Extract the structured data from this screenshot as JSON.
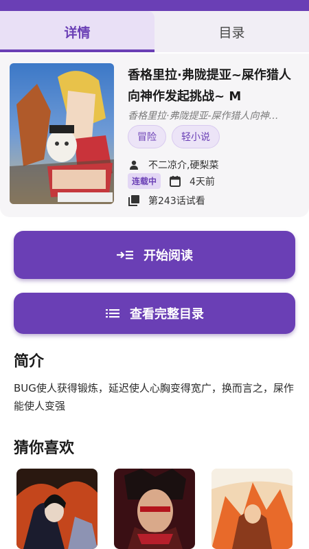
{
  "tabs": [
    {
      "label": "详情",
      "active": true
    },
    {
      "label": "目录",
      "active": false
    }
  ],
  "comic": {
    "title": "香格里拉·弗陇提亚~屎作猎人向神作发起挑战~ M",
    "subtitle": "香格里拉·弗陇提亚-屎作猎人向神…",
    "tags": [
      "冒险",
      "轻小说"
    ],
    "authors": "不二凉介,硬梨菜",
    "status_badge": "连载中",
    "updated": "4天前",
    "trial": "第243话试看"
  },
  "actions": {
    "start_reading": "开始阅读",
    "view_catalog": "查看完整目录"
  },
  "intro": {
    "heading": "简介",
    "text": "BUG使人获得锻炼，延迟使人心胸变得宽广，换而言之，屎作能使人变强"
  },
  "recommend": {
    "heading": "猜你喜欢",
    "items": [
      "rec-1",
      "rec-2",
      "rec-3"
    ]
  },
  "colors": {
    "accent": "#6a3fb5",
    "tag_bg": "#ece4f7"
  }
}
